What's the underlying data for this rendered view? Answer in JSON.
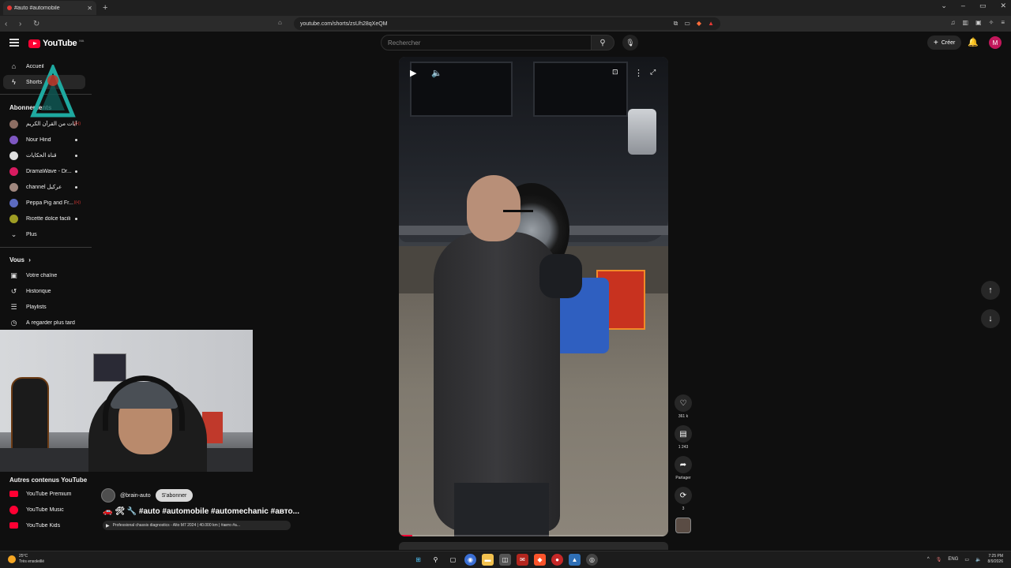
{
  "browser": {
    "tab_title": "#auto #automobile",
    "new_tab": "+",
    "url": "youtube.com/shorts/zsUh28qXeQM",
    "window_controls": [
      "⌄",
      "–",
      "▭",
      "✕"
    ]
  },
  "youtube": {
    "logo_text": "YouTube",
    "logo_country": "MA",
    "search_placeholder": "Rechercher",
    "create_label": "Créer",
    "avatar_letter": "M"
  },
  "sidebar": {
    "main": [
      {
        "label": "Accueil",
        "icon": "home-icon"
      },
      {
        "label": "Shorts",
        "icon": "shorts-icon"
      }
    ],
    "subscriptions_title": "Abonnements",
    "subscriptions": [
      {
        "label": "آيات من القرآن الكريم",
        "color": "#8d6e63",
        "badge": "live"
      },
      {
        "label": "Nour Hind",
        "color": "#7e57c2",
        "badge": "dot"
      },
      {
        "label": "قناة الحكايات",
        "color": "#eeeeee",
        "badge": "dot"
      },
      {
        "label": "DramaWave - Dr...",
        "color": "#d81b60",
        "badge": "dot"
      },
      {
        "label": "channel عركيل",
        "color": "#a1887f",
        "badge": "dot"
      },
      {
        "label": "Peppa Pig and Fr...",
        "color": "#5c6bc0",
        "badge": "live"
      },
      {
        "label": "Ricette dolce facili",
        "color": "#9e9d24",
        "badge": "dot"
      }
    ],
    "more_label": "Plus",
    "you_title": "Vous",
    "you_items": [
      {
        "label": "Votre chaîne",
        "icon": "channel-icon"
      },
      {
        "label": "Historique",
        "icon": "history-icon"
      },
      {
        "label": "Playlists",
        "icon": "playlist-icon"
      },
      {
        "label": "À regarder plus tard",
        "icon": "watch-later-icon"
      }
    ],
    "other_title": "Autres contenus YouTube",
    "other_items": [
      {
        "label": "YouTube Premium"
      },
      {
        "label": "YouTube Music"
      },
      {
        "label": "YouTube Kids"
      }
    ]
  },
  "video": {
    "channel": "@brain-auto",
    "subscribe_label": "S'abonner",
    "title": "🚗 🛠 🔧 #auto #automobile #automechanic #авто...",
    "related": "Professional chassis diagnostics - Alto M7 2024 | 40.000 km | #авто #а...",
    "progress": 0.05
  },
  "actions": {
    "likes": "361 k",
    "comments": "1 243",
    "share_label": "Partager",
    "remix": "3"
  },
  "taskbar": {
    "temp": "25°C",
    "weather": "Très ensoleillé",
    "lang": "ENG",
    "time": "7:25 PM",
    "date": "8/9/2026"
  }
}
